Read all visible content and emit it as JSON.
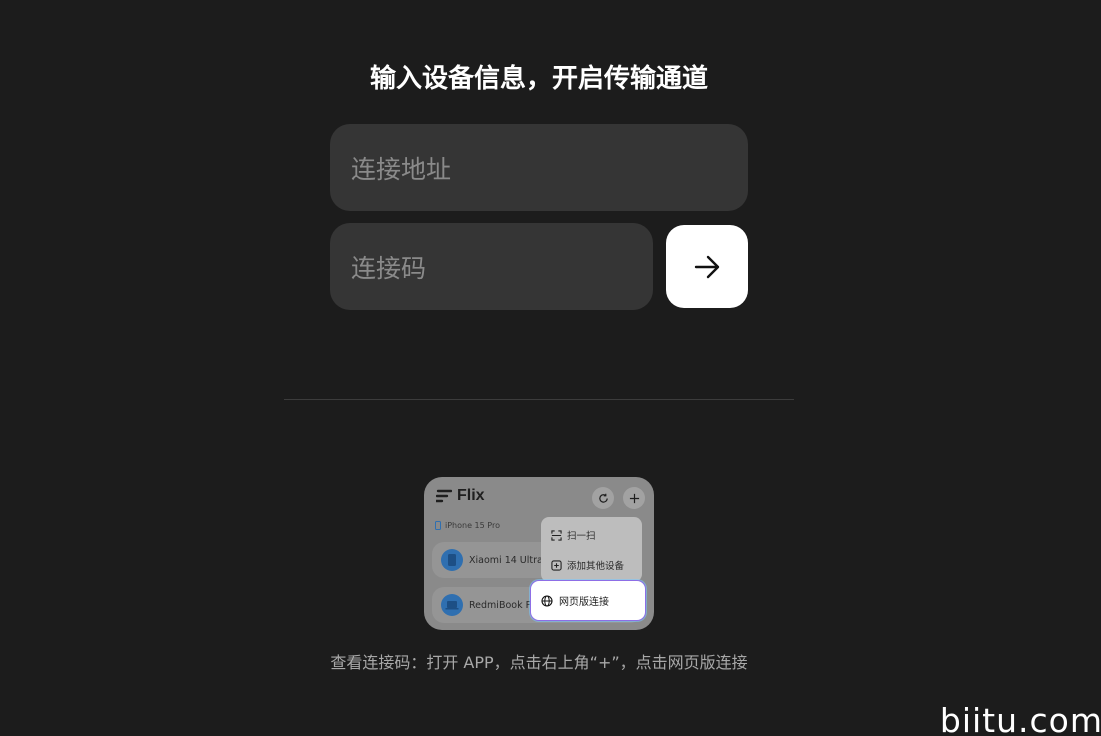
{
  "header": {
    "title": "输入设备信息，开启传输通道"
  },
  "form": {
    "address_placeholder": "连接地址",
    "code_placeholder": "连接码",
    "submit_icon": "arrow-right-icon"
  },
  "preview": {
    "brand": "Flix",
    "current_device": "iPhone 15 Pro",
    "devices": [
      {
        "name": "Xiaomi 14 Ultra",
        "icon": "phone-icon"
      },
      {
        "name": "RedmiBook Pr",
        "icon": "laptop-icon"
      }
    ],
    "menu": [
      {
        "label": "扫一扫",
        "icon": "scan-icon"
      },
      {
        "label": "添加其他设备",
        "icon": "add-box-icon"
      }
    ],
    "highlight_item": {
      "label": "网页版连接",
      "icon": "globe-icon"
    }
  },
  "hint": {
    "text": "查看连接码：打开 APP，点击右上角“+”，点击网页版连接"
  },
  "watermark": {
    "text": "biitu.com"
  },
  "colors": {
    "background": "#1c1c1c",
    "field": "#353535",
    "placeholder": "#8a8a8a",
    "button": "#ffffff",
    "highlight_border": "#8d6ee6"
  }
}
